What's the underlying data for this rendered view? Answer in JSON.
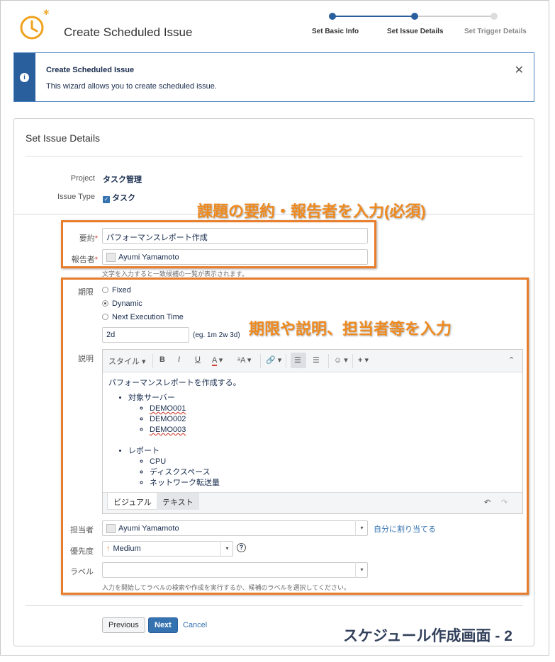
{
  "header": {
    "title": "Create Scheduled Issue",
    "steps": [
      {
        "label": "Set Basic Info",
        "state": "done"
      },
      {
        "label": "Set Issue Details",
        "state": "current"
      },
      {
        "label": "Set Trigger Details",
        "state": "pending"
      }
    ]
  },
  "banner": {
    "title": "Create Scheduled Issue",
    "text": "This wizard allows you to create scheduled issue."
  },
  "form": {
    "section_title": "Set Issue Details",
    "project_label": "Project",
    "project_value": "タスク管理",
    "issue_type_label": "Issue Type",
    "issue_type_value": "タスク",
    "summary_label": "要約",
    "summary_value": "パフォーマンスレポート作成",
    "reporter_label": "報告者",
    "reporter_value": "Ayumi Yamamoto",
    "reporter_hint": "文字を入力すると一致候補の一覧が表示されます。",
    "due_label": "期限",
    "due_options": [
      "Fixed",
      "Dynamic",
      "Next Execution Time"
    ],
    "due_selected": "Dynamic",
    "due_value": "2d",
    "due_hint": "(eg. 1m 2w 3d)",
    "description_label": "説明",
    "toolbar": {
      "style": "スタイル"
    },
    "description": {
      "intro": "パフォーマンスレポートを作成する。",
      "list1_title": "対象サーバー",
      "list1": [
        "DEMO001",
        "DEMO002",
        "DEMO003"
      ],
      "list2_title": "レポート",
      "list2": [
        "CPU",
        "ディスクスペース",
        "ネットワーク転送量"
      ]
    },
    "editor_tabs": [
      "ビジュアル",
      "テキスト"
    ],
    "assignee_label": "担当者",
    "assignee_value": "Ayumi Yamamoto",
    "assign_me": "自分に割り当てる",
    "priority_label": "優先度",
    "priority_value": "Medium",
    "labels_label": "ラベル",
    "labels_hint": "入力を開始してラベルの検索や作成を実行するか、候補のラベルを選択してください。"
  },
  "buttons": {
    "previous": "Previous",
    "next": "Next",
    "cancel": "Cancel"
  },
  "annotations": {
    "box1": "課題の要約・報告者を入力(必須)",
    "box2": "期限や説明、担当者等を入力",
    "caption": "スケジュール作成画面 - 2"
  },
  "colors": {
    "accent": "#e87d2b",
    "primary": "#3572b0",
    "banner": "#2a5f9e"
  }
}
